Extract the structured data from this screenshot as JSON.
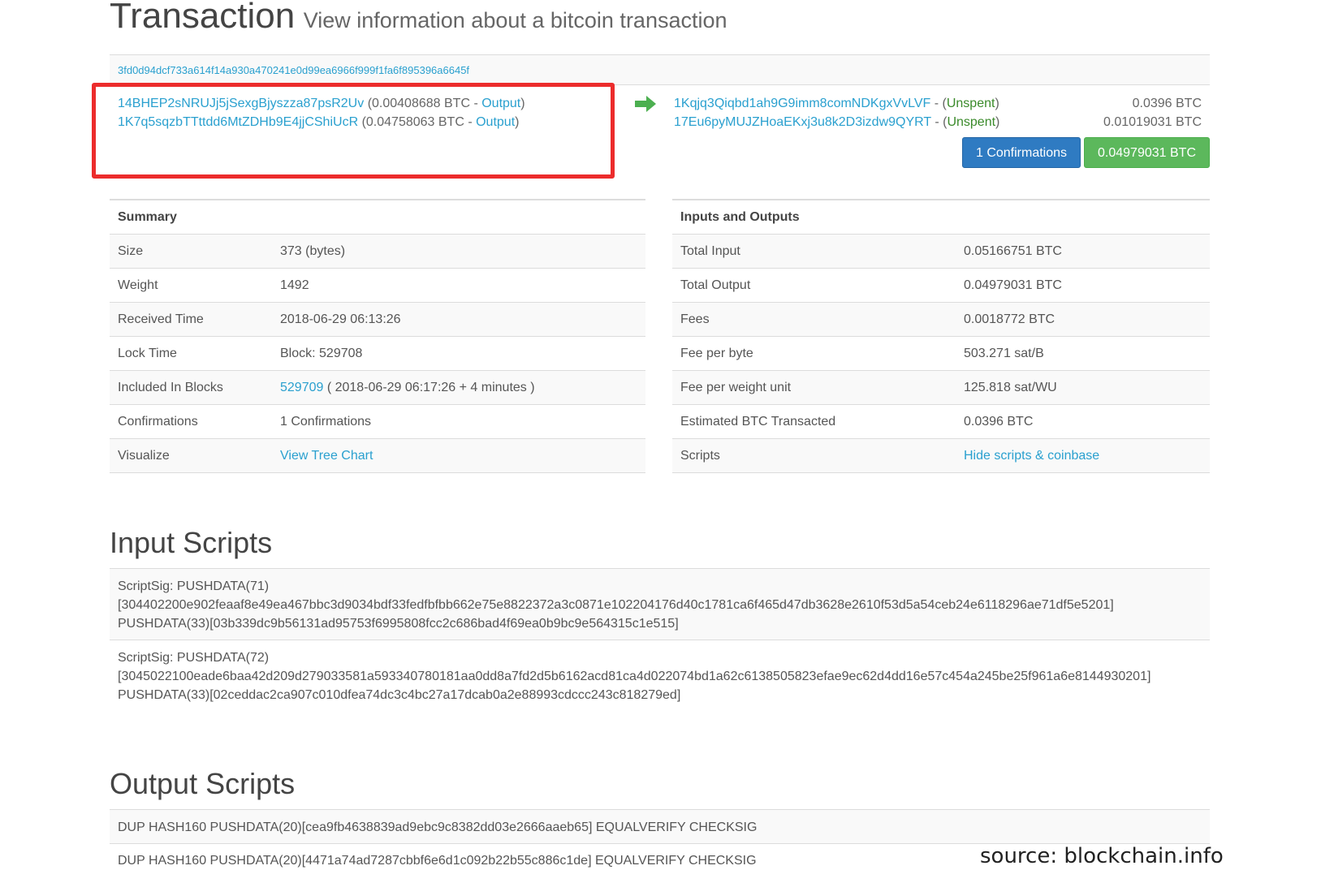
{
  "header": {
    "title": "Transaction",
    "subtitle": "View information about a bitcoin transaction"
  },
  "tx_hash": "3fd0d94dcf733a614f14a930a470241e0d99ea6966f999f1fa6f895396a6645f",
  "inputs": [
    {
      "address": "14BHEP2sNRUJj5jSexgBjyszza87psR2Uv",
      "amount": "0.00408688 BTC",
      "sep": " - ",
      "status": "Output"
    },
    {
      "address": "1K7q5sqzbTTttdd6MtZDHb9E4jjCShiUcR",
      "amount": "0.04758063 BTC",
      "sep": " - ",
      "status": "Output"
    }
  ],
  "outputs": [
    {
      "address": "1Kqjq3Qiqbd1ah9G9imm8comNDKgxVvLVF",
      "sep": " - ",
      "status": "Unspent",
      "amount": "0.0396 BTC"
    },
    {
      "address": "17Eu6pyMUJZHoaEKxj3u8k2D3izdw9QYRT",
      "sep": " - ",
      "status": "Unspent",
      "amount": "0.01019031 BTC"
    }
  ],
  "buttons": {
    "confirmations": "1 Confirmations",
    "total": "0.04979031 BTC"
  },
  "summary": {
    "heading": "Summary",
    "size_label": "Size",
    "size_value": "373 (bytes)",
    "weight_label": "Weight",
    "weight_value": "1492",
    "received_label": "Received Time",
    "received_value": "2018-06-29 06:13:26",
    "lock_label": "Lock Time",
    "lock_value": "Block: 529708",
    "included_label": "Included In Blocks",
    "included_block": "529709",
    "included_rest": " ( 2018-06-29 06:17:26 + 4 minutes )",
    "conf_label": "Confirmations",
    "conf_value": "1 Confirmations",
    "visualize_label": "Visualize",
    "visualize_value": "View Tree Chart"
  },
  "io": {
    "heading": "Inputs and Outputs",
    "total_input_label": "Total Input",
    "total_input_value": "0.05166751 BTC",
    "total_output_label": "Total Output",
    "total_output_value": "0.04979031 BTC",
    "fees_label": "Fees",
    "fees_value": "0.0018772 BTC",
    "fee_byte_label": "Fee per byte",
    "fee_byte_value": "503.271 sat/B",
    "fee_wu_label": "Fee per weight unit",
    "fee_wu_value": "125.818 sat/WU",
    "est_label": "Estimated BTC Transacted",
    "est_value": "0.0396 BTC",
    "scripts_label": "Scripts",
    "scripts_value": "Hide scripts & coinbase"
  },
  "input_scripts": {
    "title": "Input Scripts",
    "items": [
      "ScriptSig: PUSHDATA(71)\n[304402200e902feaaf8e49ea467bbc3d9034bdf33fedfbfbb662e75e8822372a3c0871e102204176d40c1781ca6f465d47db3628e2610f53d5a54ceb24e6118296ae71df5e5201]\nPUSHDATA(33)[03b339dc9b56131ad95753f6995808fcc2c686bad4f69ea0b9bc9e564315c1e515]",
      "ScriptSig: PUSHDATA(72)\n[3045022100eade6baa42d209d279033581a593340780181aa0dd8a7fd2d5b6162acd81ca4d022074bd1a62c6138505823efae9ec62d4dd16e57c454a245be25f961a6e8144930201]\nPUSHDATA(33)[02ceddac2ca907c010dfea74dc3c4bc27a17dcab0a2e88993cdccc243c818279ed]"
    ]
  },
  "output_scripts": {
    "title": "Output Scripts",
    "items": [
      "DUP HASH160 PUSHDATA(20)[cea9fb4638839ad9ebc9c8382dd03e2666aaeb65] EQUALVERIFY CHECKSIG",
      "DUP HASH160 PUSHDATA(20)[4471a74ad7287cbbf6e6d1c092b22b55c886c1de] EQUALVERIFY CHECKSIG"
    ]
  },
  "source_note": "source: blockchain.info",
  "colors": {
    "link": "#2aa0cf",
    "unspent": "#3a8a2a",
    "button_blue": "#2f7bc2",
    "button_green": "#5cb85c",
    "highlight": "#ec2c2c"
  }
}
